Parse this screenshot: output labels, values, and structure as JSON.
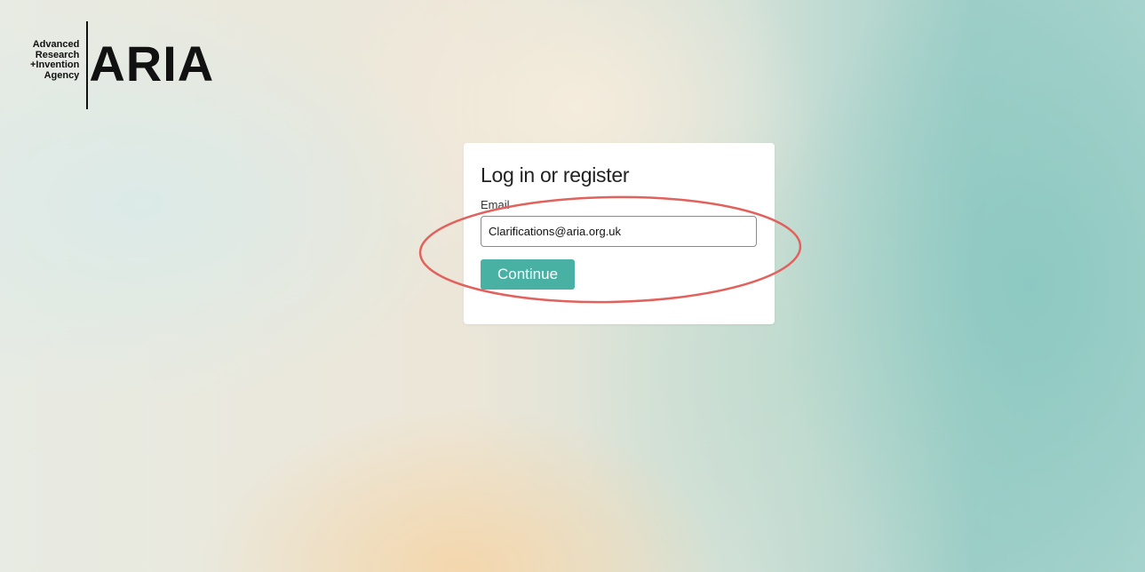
{
  "logo": {
    "subtitle_lines": [
      "Advanced",
      "Research",
      "+Invention",
      "Agency"
    ],
    "wordmark": "ARIA"
  },
  "login": {
    "title": "Log in or register",
    "email_label": "Email",
    "email_value": "Clarifications@aria.org.uk",
    "continue_label": "Continue"
  },
  "colors": {
    "accent": "#48b1a4",
    "highlight": "#e2615c"
  }
}
